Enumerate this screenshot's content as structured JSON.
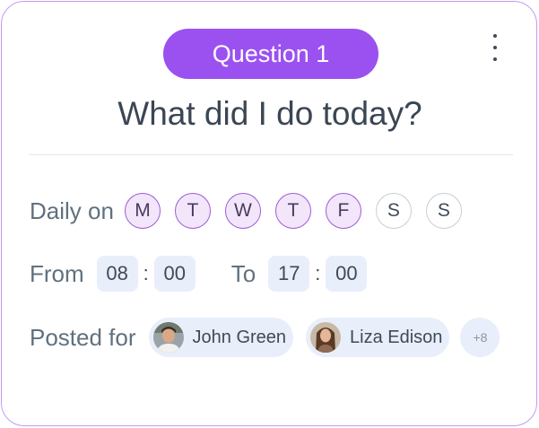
{
  "header": {
    "question_label": "Question 1",
    "menu_icon": "more-vertical-icon"
  },
  "question": {
    "title": "What did I do today?"
  },
  "schedule": {
    "label": "Daily on",
    "days": [
      {
        "letter": "M",
        "selected": true
      },
      {
        "letter": "T",
        "selected": true
      },
      {
        "letter": "W",
        "selected": true
      },
      {
        "letter": "T",
        "selected": true
      },
      {
        "letter": "F",
        "selected": true
      },
      {
        "letter": "S",
        "selected": false
      },
      {
        "letter": "S",
        "selected": false
      }
    ]
  },
  "time": {
    "from_label": "From",
    "from_hour": "08",
    "from_minute": "00",
    "separator": ":",
    "to_label": "To",
    "to_hour": "17",
    "to_minute": "00"
  },
  "posted": {
    "label": "Posted for",
    "people": [
      {
        "name": "John Green",
        "avatar": "avatar-john-green"
      },
      {
        "name": "Liza Edison",
        "avatar": "avatar-liza-edison"
      }
    ],
    "more_count": "+8"
  },
  "colors": {
    "accent": "#9b51f0",
    "card_border": "#c39bf0",
    "day_on_bg": "#f3e6fb",
    "chip_bg": "#e9eefb"
  }
}
